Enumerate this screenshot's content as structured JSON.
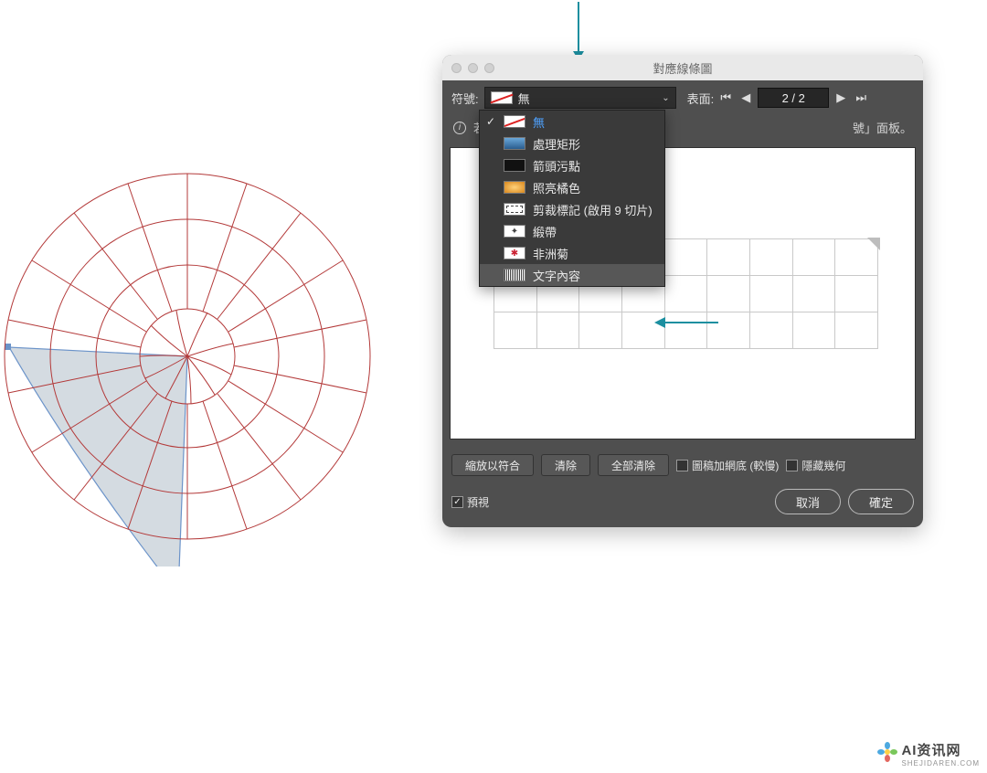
{
  "dialog": {
    "title": "對應線條圖",
    "symbol_label": "符號:",
    "selected_symbol": "無",
    "surface_label": "表面:",
    "page_value": "2 / 2",
    "info_prefix": "若",
    "info_suffix": "號」面板。"
  },
  "dropdown": {
    "items": [
      {
        "label": "無",
        "swatch": "none",
        "checked": true,
        "blue": true
      },
      {
        "label": "處理矩形",
        "swatch": "blue"
      },
      {
        "label": "箭頭污點",
        "swatch": "black"
      },
      {
        "label": "照亮橘色",
        "swatch": "orange"
      },
      {
        "label": "剪裁標記 (啟用 9 切片)",
        "swatch": "crop"
      },
      {
        "label": "緞帶",
        "swatch": "ribbon"
      },
      {
        "label": "非洲菊",
        "swatch": "flower"
      },
      {
        "label": "文字內容",
        "swatch": "text",
        "highlight": true
      }
    ]
  },
  "buttons": {
    "fit": "縮放以符合",
    "clear": "清除",
    "clear_all": "全部清除",
    "preview": "預視",
    "cancel": "取消",
    "ok": "確定"
  },
  "checkboxes": {
    "raster": "圖稿加網底 (較慢)",
    "hide_geom": "隱藏幾何"
  },
  "watermark": {
    "main": "AI资讯网",
    "sub": "SHEJIDAREN.COM"
  }
}
